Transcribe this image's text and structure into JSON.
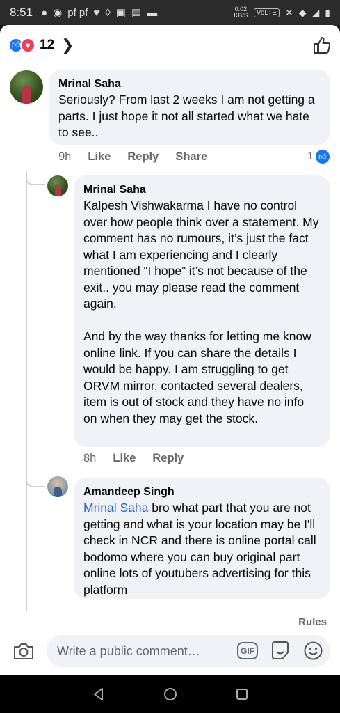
{
  "status_bar": {
    "time": "8:51",
    "notif_icons": "pf pf",
    "speed_top": "0.02",
    "speed_bottom": "KB/S",
    "volte": "VoLTE"
  },
  "header": {
    "reaction_count": "12",
    "reactions": [
      "like-icon",
      "love-icon"
    ]
  },
  "comments": [
    {
      "author": "Mrinal Saha",
      "text": "Seriously? From last 2 weeks I am not getting a parts. I just hope it not all started what we hate to see..",
      "time": "9h",
      "actions": [
        "Like",
        "Reply",
        "Share"
      ],
      "reaction_count": "1"
    },
    {
      "author": "Mrinal Saha",
      "text": "Kalpesh Vishwakarma I have no control over how people think over a statement. My comment has no rumours, it’s just the fact what I am experiencing and I clearly mentioned “I hope” it’s not because of the exit.. you may please read the comment again.\n\nAnd by the way thanks for letting me know online link. If you can share the details I would be happy. I am struggling to get ORVM mirror, contacted several dealers, item is out of stock and they have no info on when they may get the stock.",
      "time": "8h",
      "actions": [
        "Like",
        "Reply"
      ]
    },
    {
      "author": "Amandeep Singh",
      "mention": "Mrinal Saha",
      "text": " bro what part that you are not getting and what is your location may be I'll check in NCR and there is online portal call bodomo where you can buy original part online lots of youtubers advertising for this platform"
    }
  ],
  "composer": {
    "rules_label": "Rules",
    "placeholder": "Write a public comment…",
    "gif_label": "GIF"
  },
  "colors": {
    "accent": "#1877f2",
    "love": "#f33e58",
    "bubble": "#f0f2f5",
    "mention": "#1b5fbf",
    "secondary_text": "#65676b"
  }
}
